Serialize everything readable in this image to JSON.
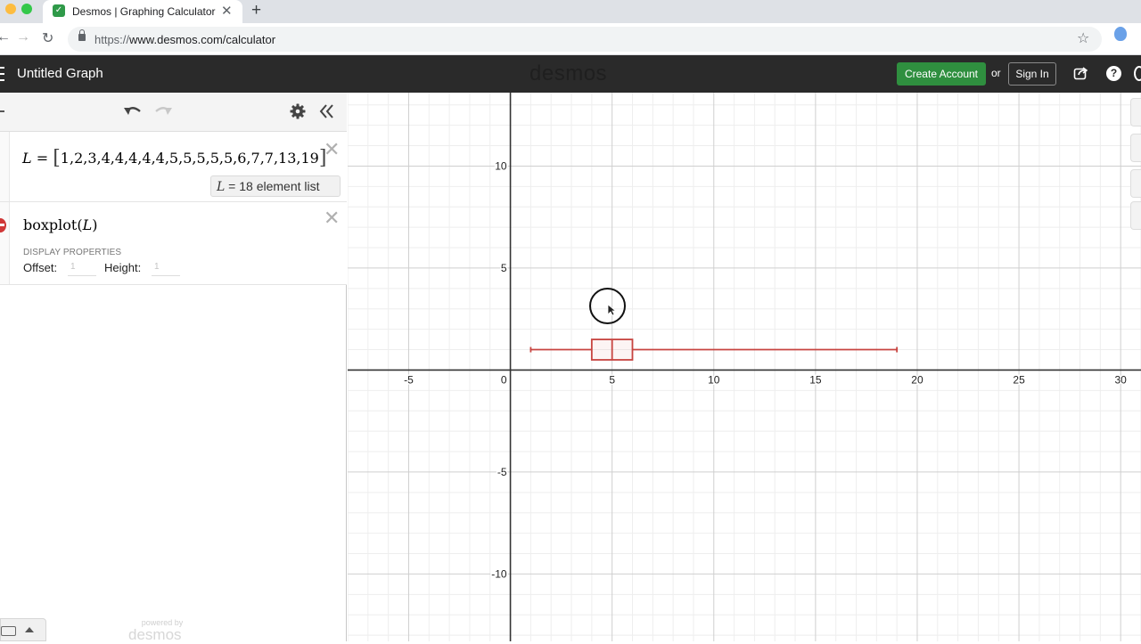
{
  "browser": {
    "tab_title": "Desmos | Graphing Calculator",
    "tab_close_icon": "close-icon",
    "new_tab_label": "+",
    "url_scheme": "https://",
    "url_rest": "www.desmos.com/calculator",
    "favicon": "desmos-favicon"
  },
  "app": {
    "graph_title": "Untitled Graph",
    "logo": "desmos",
    "create_account_label": "Create Account",
    "or_label": "or",
    "sign_in_label": "Sign In",
    "accent_color": "#2f8f3f"
  },
  "expressions": [
    {
      "var": "L",
      "equals": " = ",
      "list": "1,2,3,4,4,4,4,4,5,5,5,5,5,6,7,7,13,19",
      "eval_var": "L",
      "eval_text": " = 18 element list"
    },
    {
      "fn": "boxplot",
      "arg": "L",
      "display_properties_label": "DISPLAY PROPERTIES",
      "offset_label": "Offset:",
      "offset_placeholder": "1",
      "height_label": "Height:",
      "height_placeholder": "1",
      "status": "error"
    }
  ],
  "footer": {
    "powered_by": "powered by",
    "logo": "desmos"
  },
  "graph": {
    "x_ticks": [
      "-5",
      "0",
      "5",
      "10",
      "15",
      "20",
      "25",
      "30"
    ],
    "y_ticks": [
      "10",
      "5",
      "-5",
      "-10"
    ],
    "x_range": [
      -8,
      31
    ],
    "y_range": [
      -13.3,
      13.6
    ],
    "boxplot": {
      "min": 1,
      "q1": 4,
      "median": 5,
      "q3": 6,
      "max": 19,
      "offset": 1,
      "height": 1,
      "color": "#c74440"
    }
  }
}
